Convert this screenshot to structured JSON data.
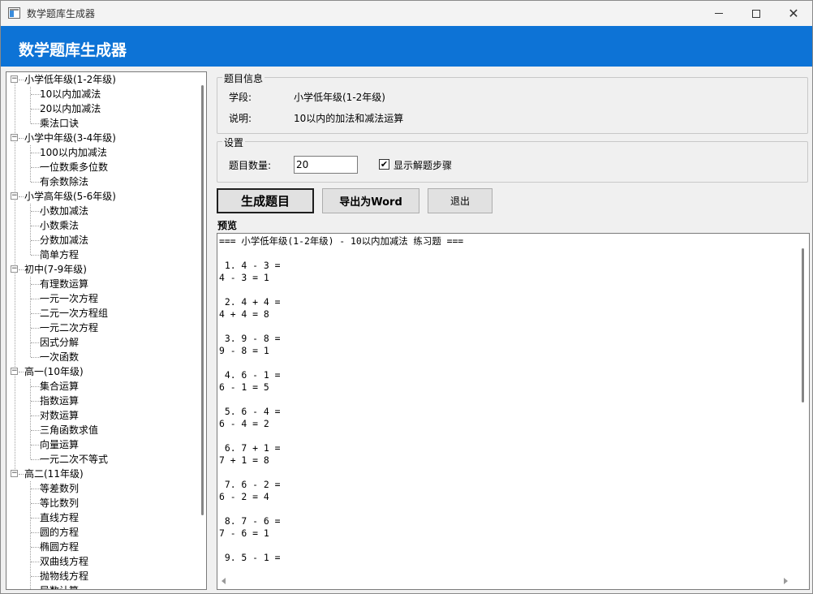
{
  "window": {
    "title": "数学题库生成器"
  },
  "header": {
    "title": "数学题库生成器"
  },
  "tree": {
    "categories": [
      {
        "label": "小学低年级(1-2年级)",
        "items": [
          "10以内加减法",
          "20以内加减法",
          "乘法口诀"
        ]
      },
      {
        "label": "小学中年级(3-4年级)",
        "items": [
          "100以内加减法",
          "一位数乘多位数",
          "有余数除法"
        ]
      },
      {
        "label": "小学高年级(5-6年级)",
        "items": [
          "小数加减法",
          "小数乘法",
          "分数加减法",
          "简单方程"
        ]
      },
      {
        "label": "初中(7-9年级)",
        "items": [
          "有理数运算",
          "一元一次方程",
          "二元一次方程组",
          "一元二次方程",
          "因式分解",
          "一次函数"
        ]
      },
      {
        "label": "高一(10年级)",
        "items": [
          "集合运算",
          "指数运算",
          "对数运算",
          "三角函数求值",
          "向量运算",
          "一元二次不等式"
        ]
      },
      {
        "label": "高二(11年级)",
        "items": [
          "等差数列",
          "等比数列",
          "直线方程",
          "圆的方程",
          "椭圆方程",
          "双曲线方程",
          "抛物线方程",
          "导数计算"
        ]
      }
    ]
  },
  "info": {
    "title": "题目信息",
    "grade_label": "学段:",
    "grade_value": "小学低年级(1-2年级)",
    "desc_label": "说明:",
    "desc_value": "10以内的加法和减法运算"
  },
  "settings": {
    "title": "设置",
    "count_label": "题目数量:",
    "count_value": "20",
    "show_steps_label": "显示解题步骤",
    "show_steps_checked": true
  },
  "buttons": {
    "generate": "生成题目",
    "export": "导出为Word",
    "exit": "退出"
  },
  "preview": {
    "label": "预览",
    "text": "=== 小学低年级(1-2年级) - 10以内加减法 练习题 ===\n\n 1. 4 - 3 =\n4 - 3 = 1\n\n 2. 4 + 4 =\n4 + 4 = 8\n\n 3. 9 - 8 =\n9 - 8 = 1\n\n 4. 6 - 1 =\n6 - 1 = 5\n\n 5. 6 - 4 =\n6 - 4 = 2\n\n 6. 7 + 1 =\n7 + 1 = 8\n\n 7. 6 - 2 =\n6 - 2 = 4\n\n 8. 7 - 6 =\n7 - 6 = 1\n\n 9. 5 - 1 ="
  },
  "colors": {
    "accent": "#0d73d6",
    "window_bg": "#f0f0f0"
  }
}
